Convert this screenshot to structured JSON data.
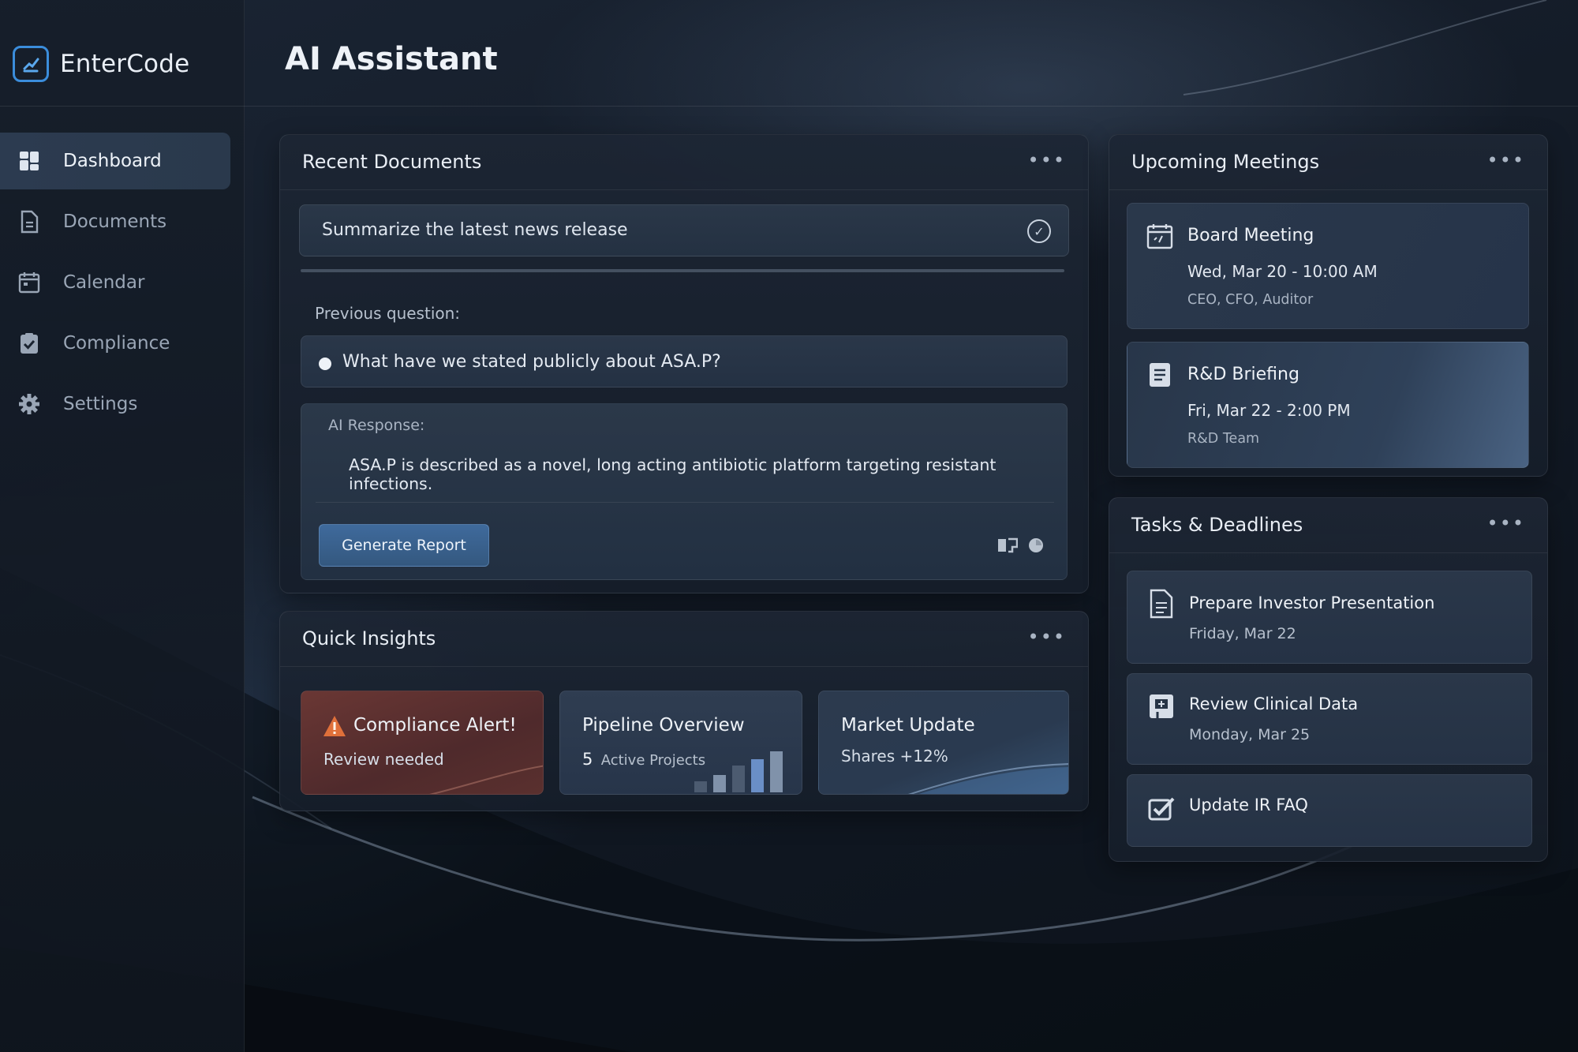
{
  "app": {
    "brand": "EnterCode",
    "page_title": "AI Assistant"
  },
  "sidebar": {
    "items": [
      {
        "label": "Dashboard",
        "icon": "dashboard-icon",
        "active": true
      },
      {
        "label": "Documents",
        "icon": "document-icon",
        "active": false
      },
      {
        "label": "Calendar",
        "icon": "calendar-icon",
        "active": false
      },
      {
        "label": "Compliance",
        "icon": "checklist-icon",
        "active": false
      },
      {
        "label": "Settings",
        "icon": "gear-icon",
        "active": false
      }
    ]
  },
  "recent_documents": {
    "title": "Recent Documents",
    "more": "•••",
    "query": "Summarize the latest news release",
    "previous_label": "Previous question:",
    "previous_question": "What have we stated publicly about ASA.P?",
    "ai_label": "AI Response:",
    "ai_response": "ASA.P is described as a novel, long acting antibiotic platform targeting resistant infections.",
    "generate_button": "Generate Report"
  },
  "quick_insights": {
    "title": "Quick Insights",
    "more": "•••",
    "cards": [
      {
        "title": "Compliance Alert!",
        "subtitle": "Review needed"
      },
      {
        "title": "Pipeline Overview",
        "count": "5",
        "subtitle": "Active Projects"
      },
      {
        "title": "Market Update",
        "subtitle": "Shares +12%"
      }
    ]
  },
  "upcoming_meetings": {
    "title": "Upcoming Meetings",
    "more": "•••",
    "items": [
      {
        "title": "Board Meeting",
        "time": "Wed, Mar 20 - 10:00 AM",
        "people": "CEO, CFO, Auditor"
      },
      {
        "title": "R&D Briefing",
        "time": "Fri, Mar 22 - 2:00 PM",
        "people": "R&D Team"
      }
    ]
  },
  "tasks": {
    "title": "Tasks & Deadlines",
    "more": "•••",
    "items": [
      {
        "title": "Prepare Investor Presentation",
        "date": "Friday, Mar 22"
      },
      {
        "title": "Review Clinical Data",
        "date": "Monday, Mar 25"
      },
      {
        "title": "Update IR FAQ",
        "date": ""
      }
    ]
  },
  "colors": {
    "accent": "#3b8ddb",
    "alert": "#e0703a",
    "button": "#3f6a9c"
  }
}
